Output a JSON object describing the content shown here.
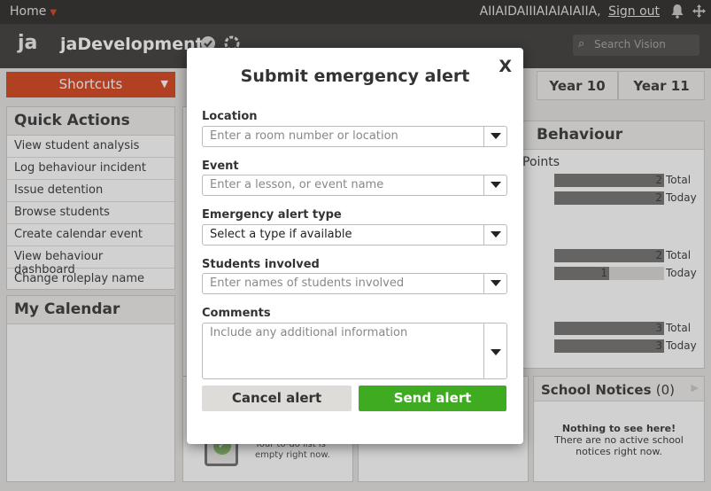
{
  "topbar": {
    "home": "Home",
    "user": "AIIAIDAIIIAIAIAIAIIA,",
    "signout": "Sign out",
    "bell_icon": "bell-icon",
    "move_icon": "move-icon"
  },
  "header": {
    "logo": "ja",
    "school": "jaDevelopment",
    "search_placeholder": "Search Vision"
  },
  "shortcuts": "Shortcuts",
  "quick_actions": {
    "title": "Quick Actions",
    "items": [
      "View student analysis",
      "Log behaviour incident",
      "Issue detention",
      "Browse students",
      "Create calendar event",
      "View behaviour dashboard",
      "Change roleplay name"
    ]
  },
  "calendar": {
    "title": "My Calendar"
  },
  "tabs": [
    "Year 10",
    "Year 11"
  ],
  "behaviour": {
    "title": "Behaviour",
    "points_label": "Points",
    "groups": [
      {
        "total": 2,
        "today": 2,
        "total_fill": 1.0,
        "today_fill": 1.0
      },
      {
        "total": 2,
        "today": 1,
        "total_fill": 1.0,
        "today_fill": 0.5
      },
      {
        "total": 3,
        "today": 3,
        "total_fill": 1.0,
        "today_fill": 1.0
      }
    ],
    "total_label": "Total",
    "today_label": "Today"
  },
  "todo": {
    "text": "Your to-do list is empty right now."
  },
  "notices": {
    "title": "School Notices",
    "count": "(0)",
    "empty_title": "Nothing to see here!",
    "empty_desc": "There are no active school notices right now."
  },
  "modal": {
    "title": "Submit emergency alert",
    "close": "X",
    "location_label": "Location",
    "location_placeholder": "Enter a room number or location",
    "event_label": "Event",
    "event_placeholder": "Enter a lesson, or event name",
    "type_label": "Emergency alert type",
    "type_value": "Select a type if available",
    "students_label": "Students involved",
    "students_placeholder": "Enter names of students involved",
    "comments_label": "Comments",
    "comments_placeholder": "Include any additional information",
    "cancel": "Cancel alert",
    "send": "Send alert"
  }
}
